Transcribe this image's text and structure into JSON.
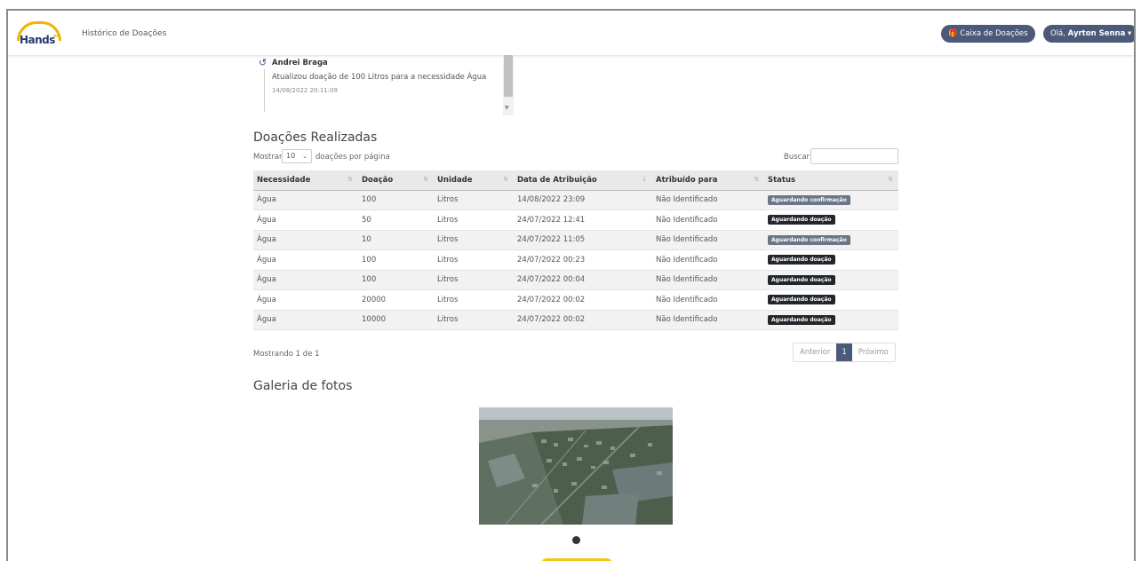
{
  "navbar": {
    "logo_text": "Hands",
    "logo_sup": "on",
    "title": "Histórico de Doações",
    "caixa_button": "Caixa de Doações",
    "user_greeting": "Olá,",
    "user_name": "Ayrton Senna",
    "caixa_icon": "gift-icon",
    "dropdown_icon": "caret-down-icon"
  },
  "timeline": {
    "icon": "history-icon",
    "name": "Andrei Braga",
    "description": "Atualizou doação de 100 Litros para a necessidade Água",
    "date": "14/08/2022 20:11:09"
  },
  "donations": {
    "title": "Doações Realizadas",
    "show_label": "Mostrar",
    "page_size": "10",
    "per_page_label": "doações por página",
    "search_label": "Buscar:",
    "columns": [
      "Necessidade",
      "Doação",
      "Unidade",
      "Data de Atribuição",
      "Atribuído para",
      "Status"
    ],
    "rows": [
      [
        "Água",
        "100",
        "Litros",
        "14/08/2022 23:09",
        "Não Identificado",
        "Aguardando confirmação"
      ],
      [
        "Água",
        "50",
        "Litros",
        "24/07/2022 12:41",
        "Não Identificado",
        "Aguardando doação"
      ],
      [
        "Água",
        "10",
        "Litros",
        "24/07/2022 11:05",
        "Não Identificado",
        "Aguardando confirmação"
      ],
      [
        "Água",
        "100",
        "Litros",
        "24/07/2022 00:23",
        "Não Identificado",
        "Aguardando doação"
      ],
      [
        "Água",
        "100",
        "Litros",
        "24/07/2022 00:04",
        "Não Identificado",
        "Aguardando doação"
      ],
      [
        "Água",
        "20000",
        "Litros",
        "24/07/2022 00:02",
        "Não Identificado",
        "Aguardando doação"
      ],
      [
        "Água",
        "10000",
        "Litros",
        "24/07/2022 00:02",
        "Não Identificado",
        "Aguardando doação"
      ]
    ],
    "status_colors": {
      "Aguardando confirmação": "#6b7786",
      "Aguardando doação": "#23272b"
    },
    "info": "Mostrando 1 de 1",
    "pagination": {
      "previous": "Anterior",
      "current": "1",
      "next": "Próximo"
    }
  },
  "gallery": {
    "title": "Galeria de fotos"
  }
}
